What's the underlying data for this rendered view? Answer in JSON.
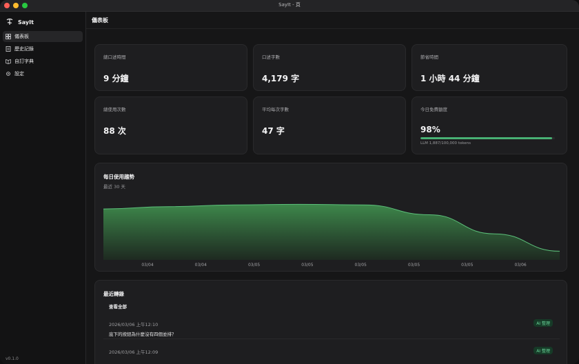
{
  "window": {
    "title": "SayIt - 頁"
  },
  "brand": {
    "name": "SayIt"
  },
  "version": "v0.1.0",
  "nav": [
    {
      "label": "儀表板",
      "icon": "dashboard-icon",
      "active": true
    },
    {
      "label": "歷史記錄",
      "icon": "history-icon",
      "active": false
    },
    {
      "label": "自訂字典",
      "icon": "book-icon",
      "active": false
    },
    {
      "label": "設定",
      "icon": "gear-icon",
      "active": false
    }
  ],
  "header": {
    "title": "儀表板"
  },
  "stats": [
    {
      "label": "總口述時間",
      "value": "9 分鐘"
    },
    {
      "label": "口述字數",
      "value": "4,179 字"
    },
    {
      "label": "節省時間",
      "value": "1 小時 44 分鐘"
    },
    {
      "label": "總使用次數",
      "value": "88 次"
    },
    {
      "label": "平均每次字數",
      "value": "47 字"
    },
    {
      "label": "今日免費額度",
      "value": "98%",
      "progress_percent": 98,
      "caption": "LLM 1,887/100,000 tokens"
    }
  ],
  "colors": {
    "accent": "#48b174",
    "background": "#161617",
    "card": "#1e1e20"
  },
  "chart_data": {
    "type": "area",
    "title": "每日使用趨勢",
    "subtitle": "最近 30 天",
    "categories": [
      "03/04",
      "03/04",
      "03/05",
      "03/05",
      "03/05",
      "03/05",
      "03/05",
      "03/06"
    ],
    "values": [
      0.88,
      0.92,
      0.95,
      0.96,
      0.95,
      0.78,
      0.45,
      0.15
    ],
    "ylim": [
      0,
      1
    ],
    "grid": false
  },
  "recent": {
    "title": "最近轉錄",
    "view_all": "查看全部",
    "items": [
      {
        "time": "2026/03/06 上午12:10",
        "text": "底下的按鈕為什麼沒有四個並排？",
        "badge": "AI 整理"
      },
      {
        "time": "2026/03/06 上午12:09",
        "text": "",
        "badge": "AI 整理"
      }
    ]
  }
}
